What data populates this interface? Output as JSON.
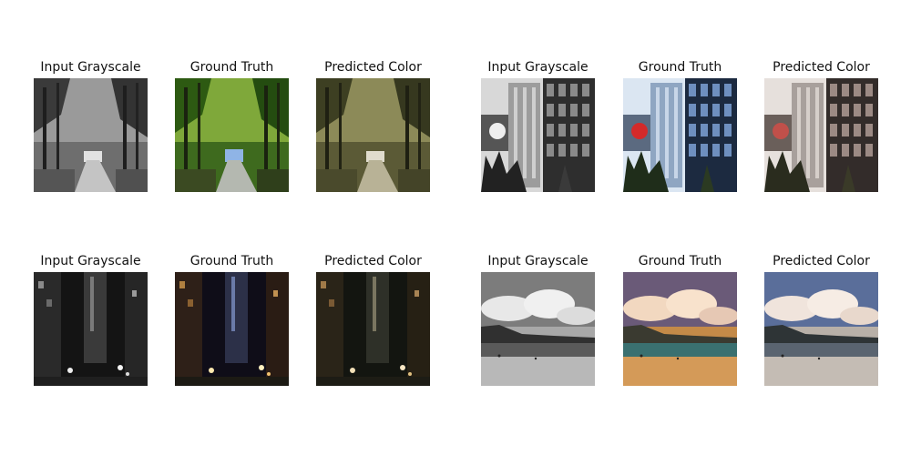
{
  "figure": {
    "groups": [
      {
        "panels": [
          {
            "title": "Input Grayscale",
            "scene": "forest road",
            "mode": "grayscale"
          },
          {
            "title": "Ground Truth",
            "scene": "forest road",
            "mode": "ground-truth"
          },
          {
            "title": "Predicted Color",
            "scene": "forest road",
            "mode": "predicted"
          }
        ]
      },
      {
        "panels": [
          {
            "title": "Input Grayscale",
            "scene": "city buildings",
            "mode": "grayscale"
          },
          {
            "title": "Ground Truth",
            "scene": "city buildings",
            "mode": "ground-truth"
          },
          {
            "title": "Predicted Color",
            "scene": "city buildings",
            "mode": "predicted"
          }
        ]
      },
      {
        "panels": [
          {
            "title": "Input Grayscale",
            "scene": "night street",
            "mode": "grayscale"
          },
          {
            "title": "Ground Truth",
            "scene": "night street",
            "mode": "ground-truth"
          },
          {
            "title": "Predicted Color",
            "scene": "night street",
            "mode": "predicted"
          }
        ]
      },
      {
        "panels": [
          {
            "title": "Input Grayscale",
            "scene": "beach with clouds",
            "mode": "grayscale"
          },
          {
            "title": "Ground Truth",
            "scene": "beach with clouds",
            "mode": "ground-truth"
          },
          {
            "title": "Predicted Color",
            "scene": "beach with clouds",
            "mode": "predicted"
          }
        ]
      }
    ]
  }
}
